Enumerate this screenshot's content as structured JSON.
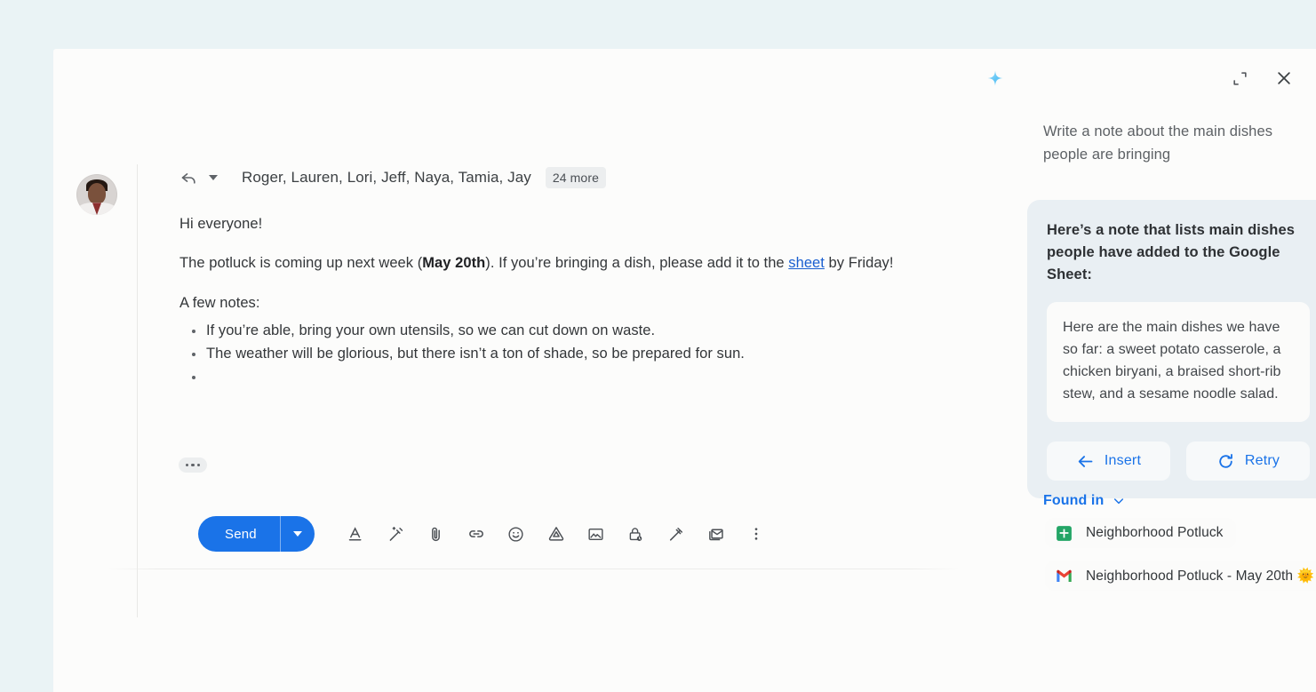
{
  "colors": {
    "page_bg": "#eaf3f5",
    "card_bg": "#fcfcfb",
    "accent_blue": "#1a73e8",
    "link_blue": "#1a5fd0",
    "panel_card_bg": "#e9eff3",
    "note_bg": "#fbfbfa",
    "text_primary": "#333639",
    "text_secondary": "#5f6368"
  },
  "compose": {
    "reply_icon": "reply-arrow-icon",
    "recipients": "Roger, Lauren, Lori, Jeff, Naya, Tamia, Jay",
    "more_chip": "24 more",
    "greeting": "Hi everyone!",
    "paragraph_prefix": "The potluck is coming up next week (",
    "paragraph_bold": "May 20th",
    "paragraph_mid": "). If you’re bringing a dish, please add it to the ",
    "paragraph_link": "sheet",
    "paragraph_suffix": " by Friday!",
    "notes_label": "A few notes:",
    "bullets": [
      "If you’re able, bring your own utensils, so we can cut down on waste.",
      "The weather will be glorious, but there isn’t a ton of shade, so be prepared for sun.",
      ""
    ],
    "trimmed_content": "show-trimmed-content",
    "toolbar": {
      "send_label": "Send",
      "send_caret": "send-options-caret",
      "tools": [
        {
          "name": "format-text-icon",
          "title": "Formatting options"
        },
        {
          "name": "magic-wand-pen-icon",
          "title": "Help me write"
        },
        {
          "name": "attach-paperclip-icon",
          "title": "Attach files"
        },
        {
          "name": "insert-link-icon",
          "title": "Insert link"
        },
        {
          "name": "insert-emoji-icon",
          "title": "Insert emoji"
        },
        {
          "name": "google-drive-icon",
          "title": "Insert files using Drive"
        },
        {
          "name": "insert-photo-icon",
          "title": "Insert photo"
        },
        {
          "name": "confidential-mode-lock-icon",
          "title": "Toggle confidential mode"
        },
        {
          "name": "insert-signature-pen-icon",
          "title": "Insert signature"
        },
        {
          "name": "email-template-icon",
          "title": "More options"
        },
        {
          "name": "more-vert-icon",
          "title": "More options"
        }
      ]
    }
  },
  "panel": {
    "sparkle_icon": "gemini-sparkle-icon",
    "expand_icon": "expand-panel-icon",
    "close_icon": "close-icon",
    "prompt": "Write a note about the main dishes people are bringing",
    "result_heading": "Here’s a note that lists main dishes people have added to the Google Sheet:",
    "note": "Here are the main dishes we have so far: a sweet potato casserole, a chicken biryani, a braised short-rib stew, and a sesame noodle salad.",
    "actions": [
      {
        "label": "Insert",
        "icon": "insert-arrow-left-icon"
      },
      {
        "label": "Retry",
        "icon": "retry-refresh-icon"
      }
    ],
    "found_in_label": "Found in",
    "found_in_chevron": "chevron-down-icon",
    "sources": [
      {
        "label": "Neighborhood Potluck",
        "icon": "google-sheets-icon"
      },
      {
        "label": "Neighborhood Potluck - May 20th 🌞",
        "icon": "gmail-icon"
      }
    ]
  }
}
